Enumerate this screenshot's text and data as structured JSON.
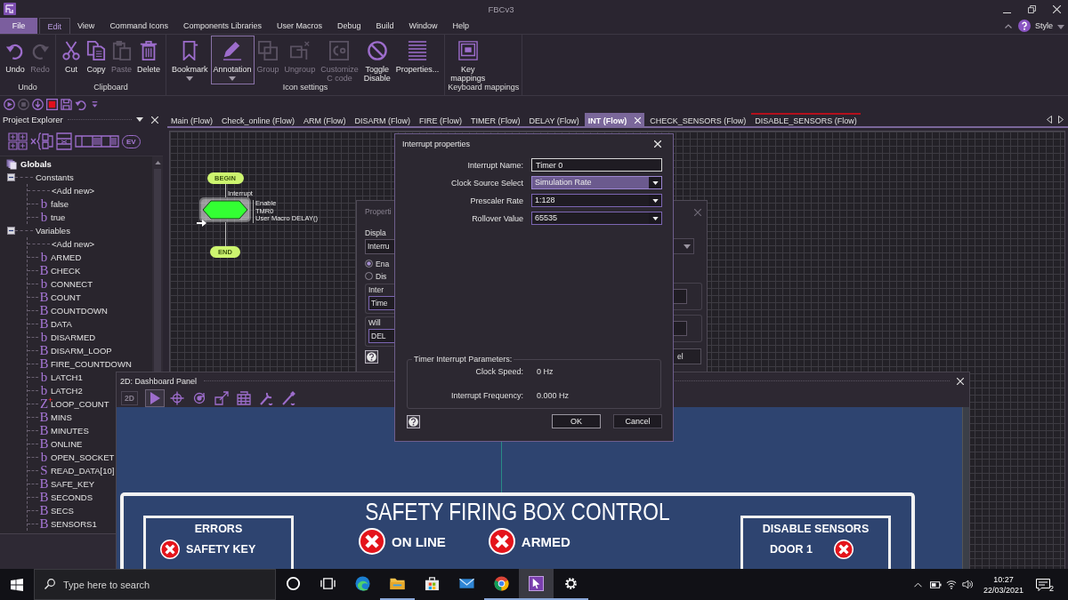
{
  "title_bar": {
    "title": "FBCv3"
  },
  "menu_tabs": [
    {
      "label": "File",
      "kind": "backstage",
      "selected": false
    },
    {
      "label": "Edit",
      "kind": "tab",
      "selected": true
    },
    {
      "label": "View",
      "kind": "tab",
      "selected": false
    },
    {
      "label": "Command Icons",
      "kind": "tab",
      "selected": false
    },
    {
      "label": "Components Libraries",
      "kind": "tab",
      "selected": false
    },
    {
      "label": "User Macros",
      "kind": "tab",
      "selected": false
    },
    {
      "label": "Debug",
      "kind": "tab",
      "selected": false
    },
    {
      "label": "Build",
      "kind": "tab",
      "selected": false
    },
    {
      "label": "Window",
      "kind": "tab",
      "selected": false
    },
    {
      "label": "Help",
      "kind": "tab",
      "selected": false
    }
  ],
  "style_menu": {
    "label": "Style"
  },
  "ribbon": {
    "groups": [
      {
        "label": "Undo",
        "buttons": [
          {
            "kind": "undo",
            "label": "Undo",
            "disabled": false,
            "hovered": false,
            "has_menu": false
          },
          {
            "kind": "redo",
            "label": "Redo",
            "disabled": true,
            "hovered": false,
            "has_menu": false
          }
        ]
      },
      {
        "label": "Clipboard",
        "buttons": [
          {
            "kind": "cut",
            "label": "Cut",
            "disabled": false,
            "hovered": false,
            "has_menu": false
          },
          {
            "kind": "copy",
            "label": "Copy",
            "disabled": false,
            "hovered": false,
            "has_menu": false
          },
          {
            "kind": "paste",
            "label": "Paste",
            "disabled": true,
            "hovered": false,
            "has_menu": false
          },
          {
            "kind": "delete",
            "label": "Delete",
            "disabled": false,
            "hovered": false,
            "has_menu": false
          }
        ]
      },
      {
        "label": "Icon settings",
        "buttons": [
          {
            "kind": "bookmark",
            "label": "Bookmark",
            "disabled": false,
            "hovered": false,
            "has_menu": true
          },
          {
            "kind": "annotation",
            "label": "Annotation",
            "disabled": false,
            "hovered": true,
            "has_menu": true
          },
          {
            "kind": "group",
            "label": "Group",
            "disabled": true,
            "hovered": false,
            "has_menu": false
          },
          {
            "kind": "ungroup",
            "label": "Ungroup",
            "disabled": true,
            "hovered": false,
            "has_menu": false
          },
          {
            "kind": "customize",
            "label": "Customize C code",
            "disabled": true,
            "hovered": false,
            "has_menu": false
          },
          {
            "kind": "toggle",
            "label": "Toggle Disable",
            "disabled": false,
            "hovered": false,
            "has_menu": false
          },
          {
            "kind": "properties",
            "label": "Properties...",
            "disabled": false,
            "hovered": false,
            "has_menu": false
          }
        ]
      },
      {
        "label": "Keyboard mappings",
        "buttons": [
          {
            "kind": "key",
            "label": "Key mappings",
            "disabled": false,
            "hovered": false,
            "has_menu": false
          }
        ]
      }
    ]
  },
  "quick_access": [
    {
      "kind": "run",
      "disabled": false
    },
    {
      "kind": "stop",
      "disabled": true
    },
    {
      "kind": "step",
      "disabled": false
    },
    {
      "kind": "record",
      "disabled": false
    },
    {
      "kind": "save",
      "disabled": false
    },
    {
      "kind": "undo",
      "disabled": false
    },
    {
      "kind": "customize",
      "disabled": false
    }
  ],
  "project_explorer": {
    "title": "Project Explorer",
    "event_tag": "EV",
    "tree": [
      {
        "label": "Globals",
        "kind": "root",
        "children": [
          {
            "label": "Constants",
            "kind": "folder",
            "expanded": true,
            "children": [
              {
                "label": "<Add new>",
                "kind": "add"
              },
              {
                "label": "false",
                "kind": "variable",
                "glyph": "b"
              },
              {
                "label": "true",
                "kind": "variable",
                "glyph": "b"
              }
            ]
          },
          {
            "label": "Variables",
            "kind": "folder",
            "expanded": true,
            "children": [
              {
                "label": "<Add new>",
                "kind": "add"
              },
              {
                "label": "ARMED",
                "kind": "variable",
                "glyph": "b"
              },
              {
                "label": "CHECK",
                "kind": "variable",
                "glyph": "B"
              },
              {
                "label": "CONNECT",
                "kind": "variable",
                "glyph": "b"
              },
              {
                "label": "COUNT",
                "kind": "variable",
                "glyph": "B"
              },
              {
                "label": "COUNTDOWN",
                "kind": "variable",
                "glyph": "B"
              },
              {
                "label": "DATA",
                "kind": "variable",
                "glyph": "B"
              },
              {
                "label": "DISARMED",
                "kind": "variable",
                "glyph": "b"
              },
              {
                "label": "DISARM_LOOP",
                "kind": "variable",
                "glyph": "B"
              },
              {
                "label": "FIRE_COUNTDOWN",
                "kind": "variable",
                "glyph": "B"
              },
              {
                "label": "LATCH1",
                "kind": "variable",
                "glyph": "b"
              },
              {
                "label": "LATCH2",
                "kind": "variable",
                "glyph": "b"
              },
              {
                "label": "LOOP_COUNT",
                "kind": "variable",
                "glyph": "Z$^{+}$"
              },
              {
                "label": "MINS",
                "kind": "variable",
                "glyph": "B"
              },
              {
                "label": "MINUTES",
                "kind": "variable",
                "glyph": "B"
              },
              {
                "label": "ONLINE",
                "kind": "variable",
                "glyph": "B"
              },
              {
                "label": "OPEN_SOCKET",
                "kind": "variable",
                "glyph": "b"
              },
              {
                "label": "READ_DATA[10]",
                "kind": "variable",
                "glyph": "S"
              },
              {
                "label": "SAFE_KEY",
                "kind": "variable",
                "glyph": "B"
              },
              {
                "label": "SECONDS",
                "kind": "variable",
                "glyph": "B"
              },
              {
                "label": "SECS",
                "kind": "variable",
                "glyph": "B"
              },
              {
                "label": "SENSORS1",
                "kind": "variable",
                "glyph": "B"
              }
            ]
          }
        ]
      }
    ]
  },
  "editor_tabs": [
    {
      "label": "Main (Flow)",
      "selected": false,
      "flagged": false
    },
    {
      "label": "Check_online (Flow)",
      "selected": false,
      "flagged": false
    },
    {
      "label": "ARM (Flow)",
      "selected": false,
      "flagged": false
    },
    {
      "label": "DISARM (Flow)",
      "selected": false,
      "flagged": false
    },
    {
      "label": "FIRE (Flow)",
      "selected": false,
      "flagged": false
    },
    {
      "label": "TIMER (Flow)",
      "selected": false,
      "flagged": false
    },
    {
      "label": "DELAY (Flow)",
      "selected": false,
      "flagged": false
    },
    {
      "label": "INT (Flow)",
      "selected": true,
      "flagged": false
    },
    {
      "label": "CHECK_SENSORS (Flow)",
      "selected": false,
      "flagged": false
    },
    {
      "label": "DISABLE_SENSORS (Flow)",
      "selected": false,
      "flagged": true
    }
  ],
  "flowchart": {
    "nodes": [
      {
        "kind": "terminal",
        "label": "BEGIN",
        "selected": false
      },
      {
        "kind": "interrupt",
        "label": "Interrupt",
        "selected": true,
        "details": [
          "Enable",
          "TMR0",
          "User Macro DELAY()"
        ]
      },
      {
        "kind": "terminal",
        "label": "END",
        "selected": false
      }
    ]
  },
  "properties_dialog": {
    "title": "Properti",
    "display_label": "Displa",
    "display_value": "Interru",
    "radios": [
      {
        "label": "Ena",
        "selected": true
      },
      {
        "label": "Dis",
        "selected": false
      }
    ],
    "groups": [
      {
        "label": "Inter",
        "value": "Time"
      },
      {
        "label": "Will",
        "value": "DEL"
      }
    ],
    "button": {
      "label": "el"
    }
  },
  "interrupt_dialog": {
    "title": "Interrupt properties",
    "fields": [
      {
        "label": "Interrupt Name:",
        "value": "Timer 0",
        "kind": "text",
        "focused": false
      },
      {
        "label": "Clock Source Select",
        "value": "Simulation Rate",
        "kind": "dropdown",
        "focused": true
      },
      {
        "label": "Prescaler Rate",
        "value": "1:128",
        "kind": "dropdown",
        "focused": false
      },
      {
        "label": "Rollover Value",
        "value": "65535",
        "kind": "dropdown",
        "focused": false
      }
    ],
    "parameters": {
      "title": "Timer Interrupt Parameters:",
      "rows": [
        {
          "label": "Clock Speed:",
          "value": "0 Hz"
        },
        {
          "label": "Interrupt Frequency:",
          "value": "0.000 Hz"
        }
      ]
    },
    "buttons": [
      {
        "label": "OK",
        "default": true
      },
      {
        "label": "Cancel",
        "default": false
      }
    ]
  },
  "dashboard": {
    "title": "2D: Dashboard Panel",
    "view_button": {
      "label": "2D",
      "disabled": true
    },
    "tools": [
      {
        "kind": "pointer",
        "selected": true
      },
      {
        "kind": "move",
        "selected": false
      },
      {
        "kind": "rotate",
        "selected": false
      },
      {
        "kind": "scale",
        "selected": false
      },
      {
        "kind": "table",
        "selected": false
      },
      {
        "kind": "wrench",
        "selected": false
      },
      {
        "kind": "brush",
        "selected": false
      }
    ],
    "panel": {
      "heading": "SAFETY FIRING BOX CONTROL",
      "errors": {
        "title": "ERRORS",
        "indicators": [
          {
            "label": "SAFETY KEY",
            "on": false
          }
        ]
      },
      "status": [
        {
          "label": "ON LINE",
          "on": false
        },
        {
          "label": "ARMED",
          "on": false
        }
      ],
      "sensors": {
        "title": "DISABLE SENSORS",
        "indicators": [
          {
            "label": "DOOR 1",
            "on": false
          }
        ]
      }
    }
  },
  "taskbar": {
    "search": {
      "placeholder": "Type here to search"
    },
    "apps": [
      {
        "kind": "cortana",
        "running": false,
        "selected": false
      },
      {
        "kind": "task_view",
        "running": false,
        "selected": false
      },
      {
        "kind": "edge",
        "running": false,
        "selected": false
      },
      {
        "kind": "explorer",
        "running": true,
        "selected": false
      },
      {
        "kind": "store",
        "running": false,
        "selected": false
      },
      {
        "kind": "mail",
        "running": false,
        "selected": false
      },
      {
        "kind": "chrome",
        "running": true,
        "selected": false
      },
      {
        "kind": "editor",
        "running": true,
        "selected": true
      },
      {
        "kind": "settings",
        "running": true,
        "selected": false
      }
    ],
    "clock": {
      "time": "10:27",
      "date": "22/03/2021"
    },
    "notifications": {
      "count": "2"
    }
  }
}
